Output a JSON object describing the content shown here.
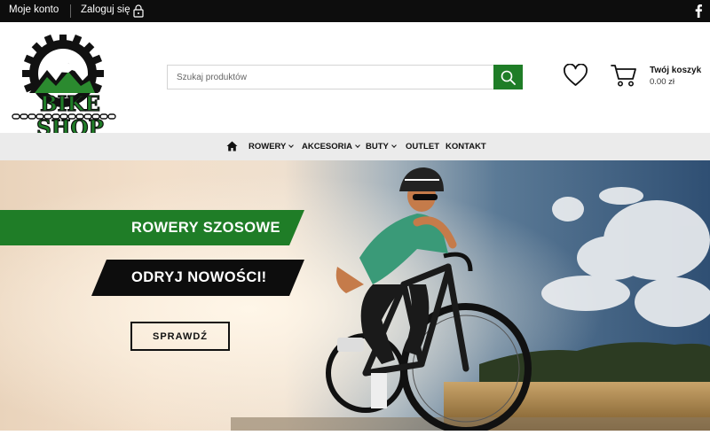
{
  "topbar": {
    "account_label": "Moje konto",
    "login_label": "Zaloguj się",
    "lock_icon": "lock-icon",
    "social_icon": "facebook-icon"
  },
  "header": {
    "logo_text": "BIKE SHOP",
    "search_placeholder": "Szukaj produktów",
    "cart_title": "Twój koszyk",
    "cart_total": "0.00 zł"
  },
  "nav": {
    "home_icon": "home-icon",
    "items": [
      {
        "label": "ROWERY",
        "dropdown": true
      },
      {
        "label": "AKCESORIA",
        "dropdown": true
      },
      {
        "label": "BUTY",
        "dropdown": true
      },
      {
        "label": "OUTLET",
        "dropdown": false
      },
      {
        "label": "KONTAKT",
        "dropdown": false
      }
    ]
  },
  "hero": {
    "headline": "ROWERY SZOSOWE",
    "subheadline": "ODRYJ NOWOŚCI!",
    "cta_label": "SPRAWDŹ"
  },
  "colors": {
    "brand_green": "#1f7d27",
    "topbar_bg": "#0d0d0d",
    "nav_bg": "#ebebeb"
  }
}
